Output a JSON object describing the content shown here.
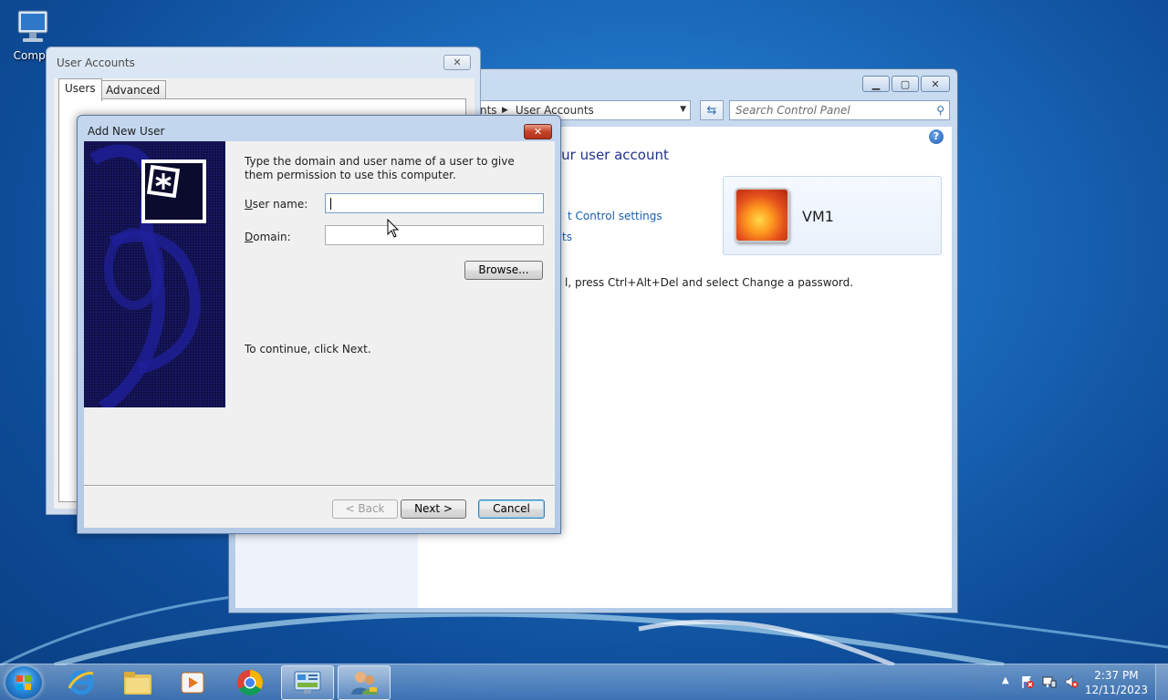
{
  "desktop": {
    "icon_label": "Compu"
  },
  "control_panel": {
    "address_segment_1": "nts",
    "address_segment_2": "User Accounts",
    "search_placeholder": "Search Control Panel",
    "heading": "our user account",
    "link_1": "t Control settings",
    "link_2": "ts",
    "password_text": "l, press Ctrl+Alt+Del and select Change a password.",
    "user_name": "VM1"
  },
  "user_accounts": {
    "title": "User Accounts",
    "tab_users": "Users",
    "tab_advanced": "Advanced"
  },
  "add_new_user": {
    "title": "Add New User",
    "intro": "Type the domain and user name of a user to give them permission to use this computer.",
    "username_label_u": "U",
    "username_label_rest": "ser name:",
    "username_value": "",
    "domain_label_u": "D",
    "domain_label_rest": "omain:",
    "domain_value": "",
    "browse_label": "Browse...",
    "continue_text": "To continue, click Next.",
    "back_label": "< Back",
    "next_label": "Next >",
    "cancel_label": "Cancel"
  },
  "taskbar": {
    "time": "2:37 PM",
    "date": "12/11/2023"
  },
  "colors": {
    "link": "#1a5fad",
    "heading": "#1e3287",
    "close_red": "#c4432a"
  }
}
